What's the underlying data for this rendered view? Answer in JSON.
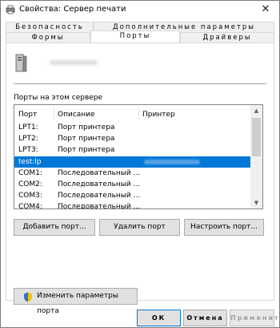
{
  "window": {
    "title": "Свойства: Сервер печати",
    "close_glyph": "✕"
  },
  "tabs": {
    "row1": [
      "Безопасность",
      "Дополнительные параметры"
    ],
    "row2": [
      "Формы",
      "Порты",
      "Драйверы"
    ],
    "active": "Порты"
  },
  "ports": {
    "section_label": "Порты на этом сервере",
    "columns": [
      "Порт",
      "Описание",
      "Принтер"
    ],
    "rows": [
      {
        "port": "LPT1:",
        "description": "Порт принтера",
        "printer": ""
      },
      {
        "port": "LPT2:",
        "description": "Порт принтера",
        "printer": ""
      },
      {
        "port": "LPT3:",
        "description": "Порт принтера",
        "printer": ""
      },
      {
        "port": "test:lp",
        "description": "",
        "printer": "",
        "selected": true
      },
      {
        "port": "COM1:",
        "description": "Последовательный ...",
        "printer": ""
      },
      {
        "port": "COM2:",
        "description": "Последовательный ...",
        "printer": ""
      },
      {
        "port": "COM3:",
        "description": "Последовательный ...",
        "printer": ""
      },
      {
        "port": "COM4:",
        "description": "Последовательный ...",
        "printer": ""
      }
    ]
  },
  "buttons": {
    "add_port": "Добавить порт...",
    "delete_port": "Удалить порт",
    "configure_port": "Настроить порт...",
    "change_settings": "Изменить параметры порта",
    "ok": "ОК",
    "cancel": "Отмена",
    "apply": "Применить"
  },
  "colors": {
    "selection": "#0078d7",
    "accent_border": "#0078d7"
  },
  "icons": {
    "title": "printer-icon",
    "server": "server-icon",
    "shield": "uac-shield-icon"
  }
}
